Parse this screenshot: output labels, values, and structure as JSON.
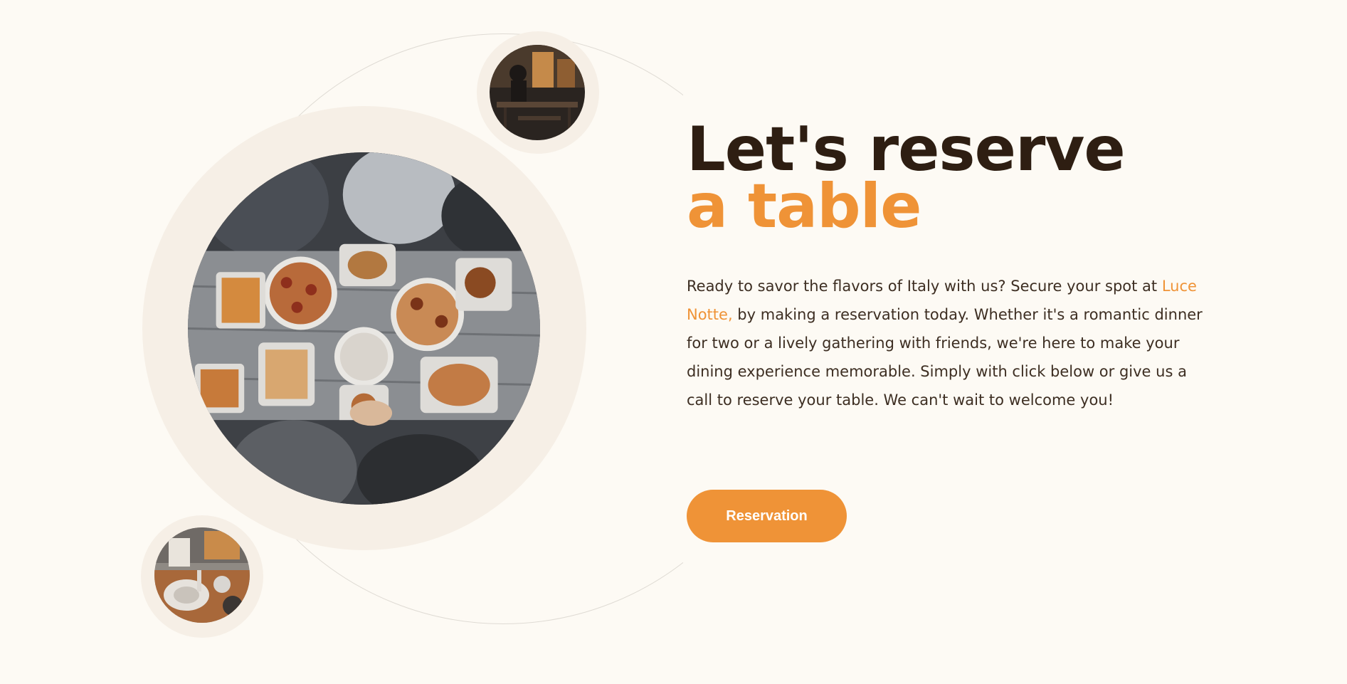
{
  "hero": {
    "headline_line1": "Let's reserve",
    "headline_line2": "a table",
    "body_before": "Ready to savor the flavors of Italy with us? Secure your spot at ",
    "body_highlight": "Luce Notte,",
    "body_after": " by making a reservation today. Whether it's a romantic dinner for two or a lively gathering with friends, we're here to make your dining experience memorable. Simply with click below or give us a call to reserve your table. We can't wait to welcome you!",
    "button_label": "Reservation"
  },
  "images": {
    "main": "food-table-photo",
    "top": "restaurant-interior-photo",
    "bottom": "dining-table-photo"
  },
  "colors": {
    "background": "#fdfaf4",
    "accent": "#ef9337",
    "heading": "#2e1e12",
    "body_text": "#3d2e22",
    "halo": "#f6efe6"
  }
}
